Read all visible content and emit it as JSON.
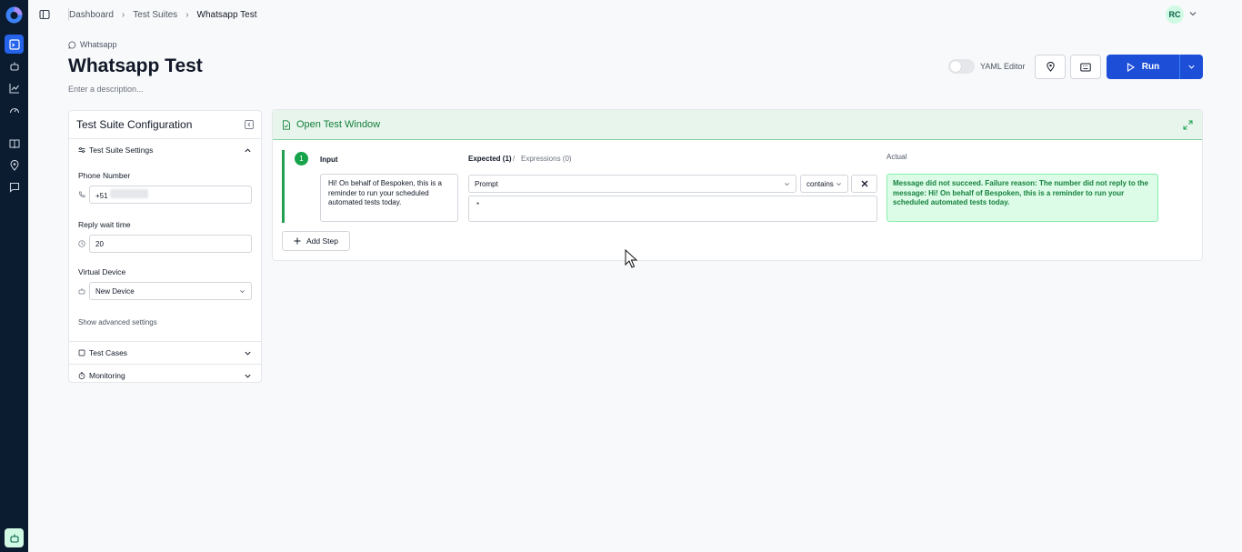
{
  "breadcrumb": {
    "items": [
      "Dashboard",
      "Test Suites",
      "Whatsapp Test"
    ]
  },
  "user": {
    "initials": "RC"
  },
  "header": {
    "channel": "Whatsapp",
    "title": "Whatsapp Test",
    "description_placeholder": "Enter a description..."
  },
  "toolbar": {
    "yaml_label": "YAML Editor",
    "run_label": "Run"
  },
  "config": {
    "title": "Test Suite Configuration",
    "settings_section": "Test Suite Settings",
    "phone_label": "Phone Number",
    "phone_value": "+51",
    "wait_label": "Reply wait time",
    "wait_value": "20",
    "device_label": "Virtual Device",
    "device_value": "New Device",
    "advanced_link": "Show advanced settings",
    "test_cases_section": "Test Cases",
    "monitoring_section": "Monitoring"
  },
  "test_window": {
    "title": "Open Test Window",
    "step_number": "1",
    "input_label": "Input",
    "expected_label": "Expected (1)",
    "separator": "/",
    "expressions_label": "Expressions (0)",
    "actual_label": "Actual",
    "input_text": "Hi! On behalf of Bespoken, this is a reminder to run your scheduled automated tests today.",
    "expected_type": "Prompt",
    "operator": "contains",
    "expected_value": "*",
    "actual_text": "Message did not succeed. Failure reason: The number did not reply to the message: Hi! On behalf of Bespoken, this is a reminder to run your scheduled automated tests today.",
    "add_step_label": "Add Step"
  },
  "colors": {
    "rail": "#0b1b30",
    "primary": "#1d4ed8",
    "success": "#16a34a",
    "success_bg": "#dcfce7"
  }
}
